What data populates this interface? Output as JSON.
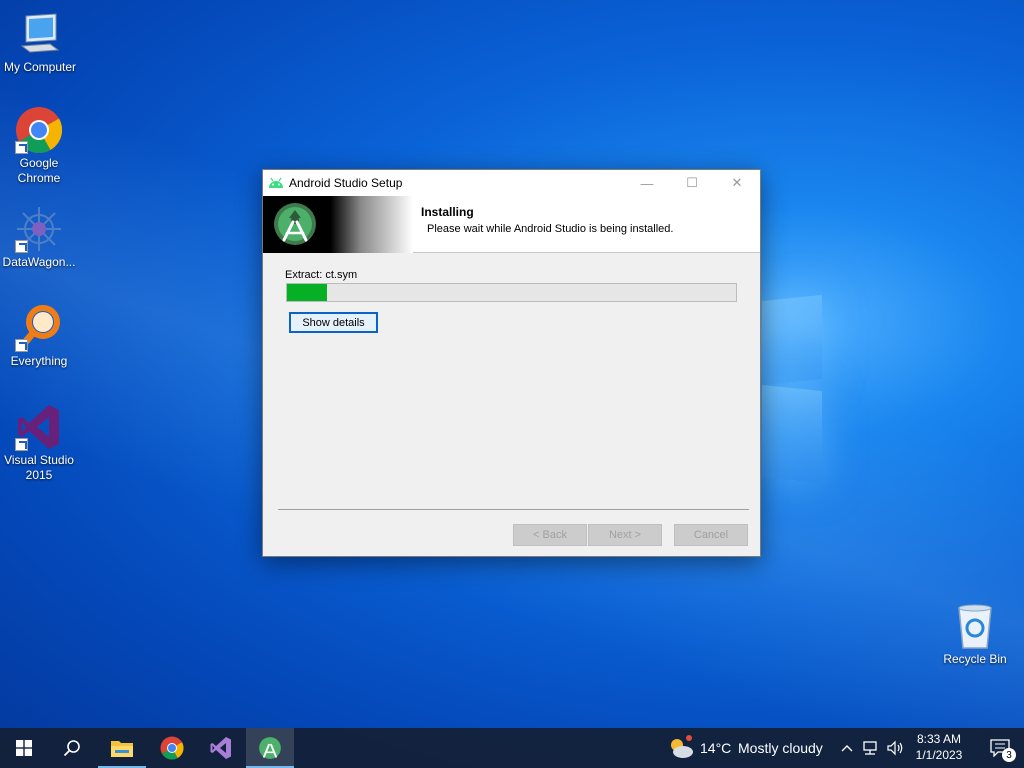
{
  "desktop": {
    "icons": [
      {
        "label": "My Computer"
      },
      {
        "label": "Google\nChrome"
      },
      {
        "label": "DataWagon..."
      },
      {
        "label": "Everything"
      },
      {
        "label": "Visual Studio\n2015"
      },
      {
        "label": "Recycle Bin"
      }
    ]
  },
  "dialog": {
    "title": "Android Studio Setup",
    "header_title": "Installing",
    "header_subtitle": "Please wait while Android Studio is being installed.",
    "status_text": "Extract: ct.sym",
    "progress": 0.09,
    "show_details_label": "Show details",
    "back_label": "< Back",
    "next_label": "Next >",
    "cancel_label": "Cancel",
    "minimize_glyph": "—",
    "maximize_glyph": "☐",
    "close_glyph": "✕"
  },
  "taskbar": {
    "weather_temp": "14°C",
    "weather_desc": "Mostly cloudy",
    "time": "8:33 AM",
    "date": "1/1/2023",
    "notification_count": "3"
  },
  "colors": {
    "progress_fill": "#06b025",
    "android_green": "#3ddc84",
    "vs_purple": "#68217a",
    "focus_border": "#0a64c8"
  }
}
